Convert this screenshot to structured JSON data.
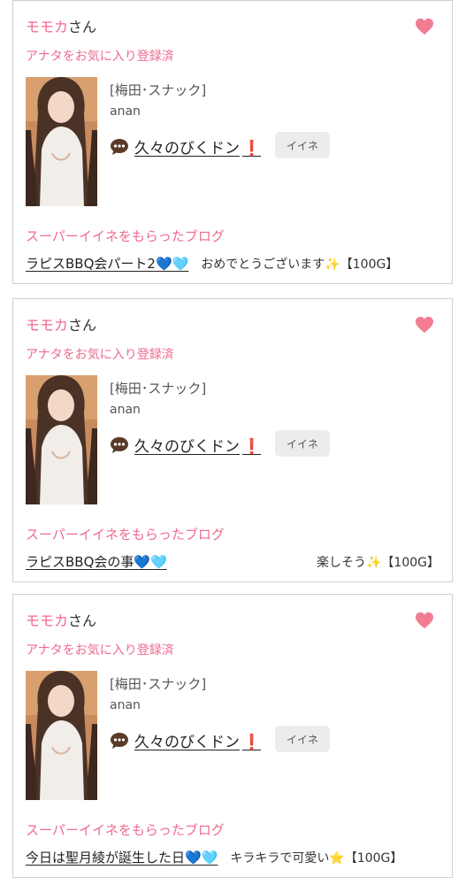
{
  "colors": {
    "accent_pink": "#f06a8e",
    "heart": "#f27d93",
    "exclaim_red": "#d41f2a",
    "button_bg": "#ececec"
  },
  "cards": [
    {
      "name": "モモカ",
      "name_suffix": "さん",
      "favorite_label": "アナタをお気に入り登録済",
      "category": "[梅田･スナック]",
      "username": "anan",
      "comment": "久々のびくドン",
      "comment_mark": "❗",
      "iine_label": "イイネ",
      "super_label": "スーパーイイネをもらったブログ",
      "blog_title": "ラピスBBQ会パート2",
      "blog_emoji_1": "💙",
      "blog_emoji_2": "🩵",
      "message": "おめでとうございます",
      "message_emoji": "✨",
      "points": "【100G】"
    },
    {
      "name": "モモカ",
      "name_suffix": "さん",
      "favorite_label": "アナタをお気に入り登録済",
      "category": "[梅田･スナック]",
      "username": "anan",
      "comment": "久々のびくドン",
      "comment_mark": "❗",
      "iine_label": "イイネ",
      "super_label": "スーパーイイネをもらったブログ",
      "blog_title": "ラピスBBQ会の事",
      "blog_emoji_1": "💙",
      "blog_emoji_2": "🩵",
      "message": "楽しそう",
      "message_emoji": "✨",
      "points": "【100G】"
    },
    {
      "name": "モモカ",
      "name_suffix": "さん",
      "favorite_label": "アナタをお気に入り登録済",
      "category": "[梅田･スナック]",
      "username": "anan",
      "comment": "久々のびくドン",
      "comment_mark": "❗",
      "iine_label": "イイネ",
      "super_label": "スーパーイイネをもらったブログ",
      "blog_title": "今日は聖月綾が誕生した日",
      "blog_emoji_1": "💙",
      "blog_emoji_2": "🩵",
      "message": "キラキラで可愛い",
      "message_emoji": "⭐",
      "points": "【100G】"
    }
  ]
}
